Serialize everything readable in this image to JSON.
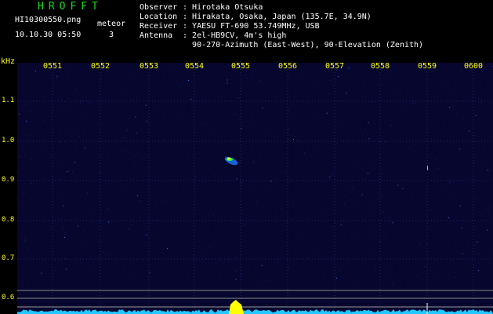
{
  "header": {
    "app_title": "HROFFT",
    "filename": "HI10300550.png",
    "datetime": "10.10.30 05:50",
    "meteor_label": "meteor",
    "meteor_count": "3"
  },
  "station": {
    "observer": {
      "label": "Observer",
      "value": "Hirotaka Otsuka"
    },
    "location": {
      "label": "Location",
      "value": "Hirakata, Osaka, Japan (135.7E, 34.9N)"
    },
    "receiver": {
      "label": "Receiver",
      "value": "YAESU FT-690 53.749MHz, USB"
    },
    "antenna": {
      "label": "Antenna",
      "value": "2el-HB9CV, 4m's high",
      "value2": "90-270-Azimuth (East-West), 90-Elevation (Zenith)"
    }
  },
  "chart_data": {
    "type": "heatmap",
    "ylabel": "kHz",
    "x_ticks": [
      "0551",
      "0552",
      "0553",
      "0554",
      "0555",
      "0556",
      "0557",
      "0558",
      "0559",
      "0600"
    ],
    "y_ticks": [
      "1.1",
      "1.0",
      "0.9",
      "0.8",
      "0.7",
      "0.6"
    ],
    "ylim": [
      0.58,
      1.15
    ],
    "meteor_echo": {
      "time": "0554.6",
      "freq_khz": 0.96
    },
    "colors": {
      "background": "#06062e",
      "tick": "#ffff00",
      "noise": "#22c7ff",
      "echo": "#ffff00"
    }
  }
}
